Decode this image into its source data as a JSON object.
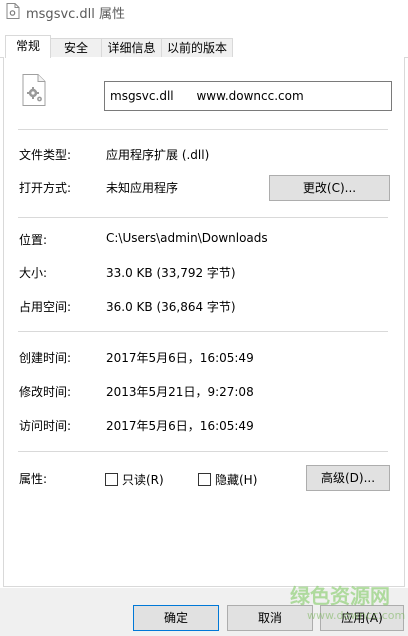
{
  "window": {
    "title": "msgsvc.dll 属性"
  },
  "tabs": [
    {
      "label": "常规",
      "active": true
    },
    {
      "label": "安全",
      "active": false
    },
    {
      "label": "详细信息",
      "active": false
    },
    {
      "label": "以前的版本",
      "active": false
    }
  ],
  "general": {
    "filename_value": "msgsvc.dll      www.downcc.com",
    "file_type_label": "文件类型:",
    "file_type_value": "应用程序扩展 (.dll)",
    "open_with_label": "打开方式:",
    "open_with_value": "未知应用程序",
    "change_button": "更改(C)...",
    "location_label": "位置:",
    "location_value": "C:\\Users\\admin\\Downloads",
    "size_label": "大小:",
    "size_value": "33.0 KB (33,792 字节)",
    "size_on_disk_label": "占用空间:",
    "size_on_disk_value": "36.0 KB (36,864 字节)",
    "created_label": "创建时间:",
    "created_value": "2017年5月6日，16:05:49",
    "modified_label": "修改时间:",
    "modified_value": "2013年5月21日，9:27:08",
    "accessed_label": "访问时间:",
    "accessed_value": "2017年5月6日，16:05:49",
    "attributes_label": "属性:",
    "readonly_label": "只读(R)",
    "readonly_checked": false,
    "hidden_label": "隐藏(H)",
    "hidden_checked": false,
    "advanced_button": "高级(D)..."
  },
  "footer": {
    "ok_button": "确定",
    "cancel_button": "取消",
    "apply_button": "应用(A)"
  },
  "watermark": {
    "text": "绿色资源网",
    "url": "www.downcc.com"
  },
  "icons": {
    "title": "dll-file-icon",
    "file": "dll-file-gear-icon"
  },
  "colors": {
    "border": "#d9d9d9",
    "button_bg": "#e1e1e1",
    "footer_bg": "#f0f0f0",
    "watermark": "#78c85a"
  }
}
